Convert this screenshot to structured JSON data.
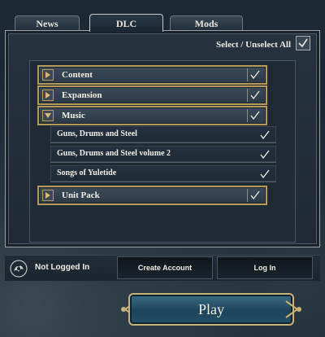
{
  "tabs": [
    {
      "label": "News",
      "active": false
    },
    {
      "label": "DLC",
      "active": true
    },
    {
      "label": "Mods",
      "active": false
    }
  ],
  "select_all": {
    "label": "Select / Unselect All",
    "checked": true
  },
  "dlc_list": {
    "categories": [
      {
        "label": "Content",
        "expanded": false,
        "checked": true
      },
      {
        "label": "Expansion",
        "expanded": false,
        "checked": true
      },
      {
        "label": "Music",
        "expanded": true,
        "checked": true
      },
      {
        "label": "Unit Pack",
        "expanded": false,
        "checked": true
      }
    ],
    "music_items": [
      {
        "label": "Guns, Drums and Steel",
        "checked": true
      },
      {
        "label": "Guns, Drums and Steel volume 2",
        "checked": true
      },
      {
        "label": "Songs of Yuletide",
        "checked": true
      }
    ]
  },
  "account": {
    "status": "Not Logged In",
    "create_account": "Create Account",
    "log_in": "Log In"
  },
  "play": {
    "label": "Play"
  },
  "icons": {
    "expand": "triangle-right-icon",
    "collapse": "triangle-down-icon",
    "check": "checkmark-icon",
    "logo": "paradox-logo-icon"
  },
  "colors": {
    "gold_border": "#b59a5a",
    "play_blue": "#1d4459",
    "panel": "#1f2a35"
  }
}
